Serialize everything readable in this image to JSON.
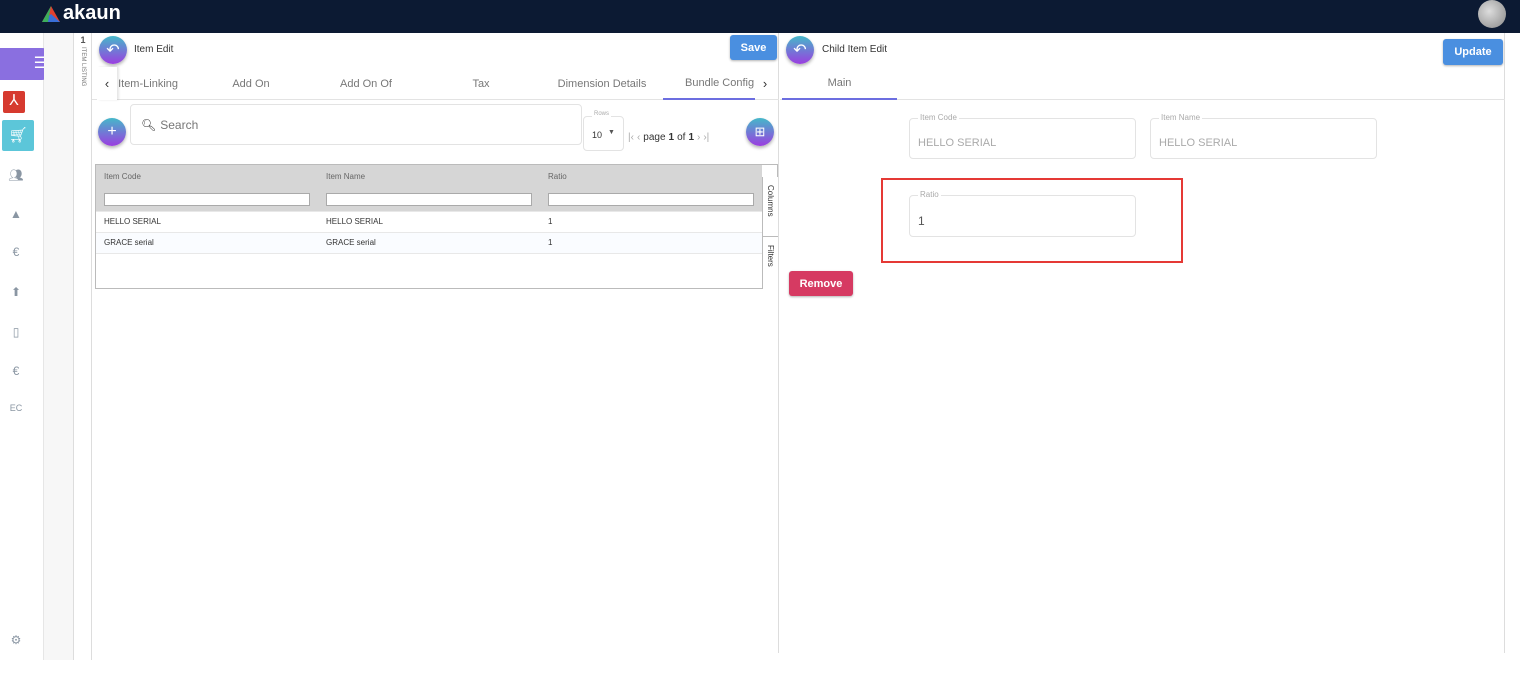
{
  "app": {
    "logo": "akaun"
  },
  "listing": {
    "count": "1",
    "label": "ITEM LISTING"
  },
  "left": {
    "title": "Item Edit",
    "save_label": "Save",
    "tabs": [
      "Item-Linking",
      "Add On",
      "Add On Of",
      "Tax",
      "Dimension Details",
      "Bundle Config"
    ],
    "active_tab": "Bundle Config",
    "search_placeholder": "Search",
    "rows_label": "Rows",
    "rows_value": "10",
    "pagination": {
      "page_word": "page",
      "page": "1",
      "of_word": "of",
      "total": "1"
    },
    "table": {
      "columns": [
        "Item Code",
        "Item Name",
        "Ratio"
      ],
      "rows": [
        [
          "HELLO SERIAL",
          "HELLO SERIAL",
          "1"
        ],
        [
          "GRACE serial",
          "GRACE serial",
          "1"
        ]
      ]
    },
    "side_panel": {
      "columns": "Columns",
      "filters": "Filters"
    }
  },
  "right": {
    "title": "Child Item Edit",
    "update_label": "Update",
    "tabs": [
      "Main"
    ],
    "fields": {
      "item_code": {
        "label": "Item Code",
        "value": "HELLO SERIAL"
      },
      "item_name": {
        "label": "Item Name",
        "value": "HELLO SERIAL"
      },
      "ratio": {
        "label": "Ratio",
        "value": "1"
      }
    },
    "remove_label": "Remove"
  },
  "colors": {
    "topbar": "#0c1a33",
    "save": "#4a8fe0",
    "remove": "#d63a62",
    "highlight": "#e53935",
    "tab_active": "#6c6ee0"
  }
}
